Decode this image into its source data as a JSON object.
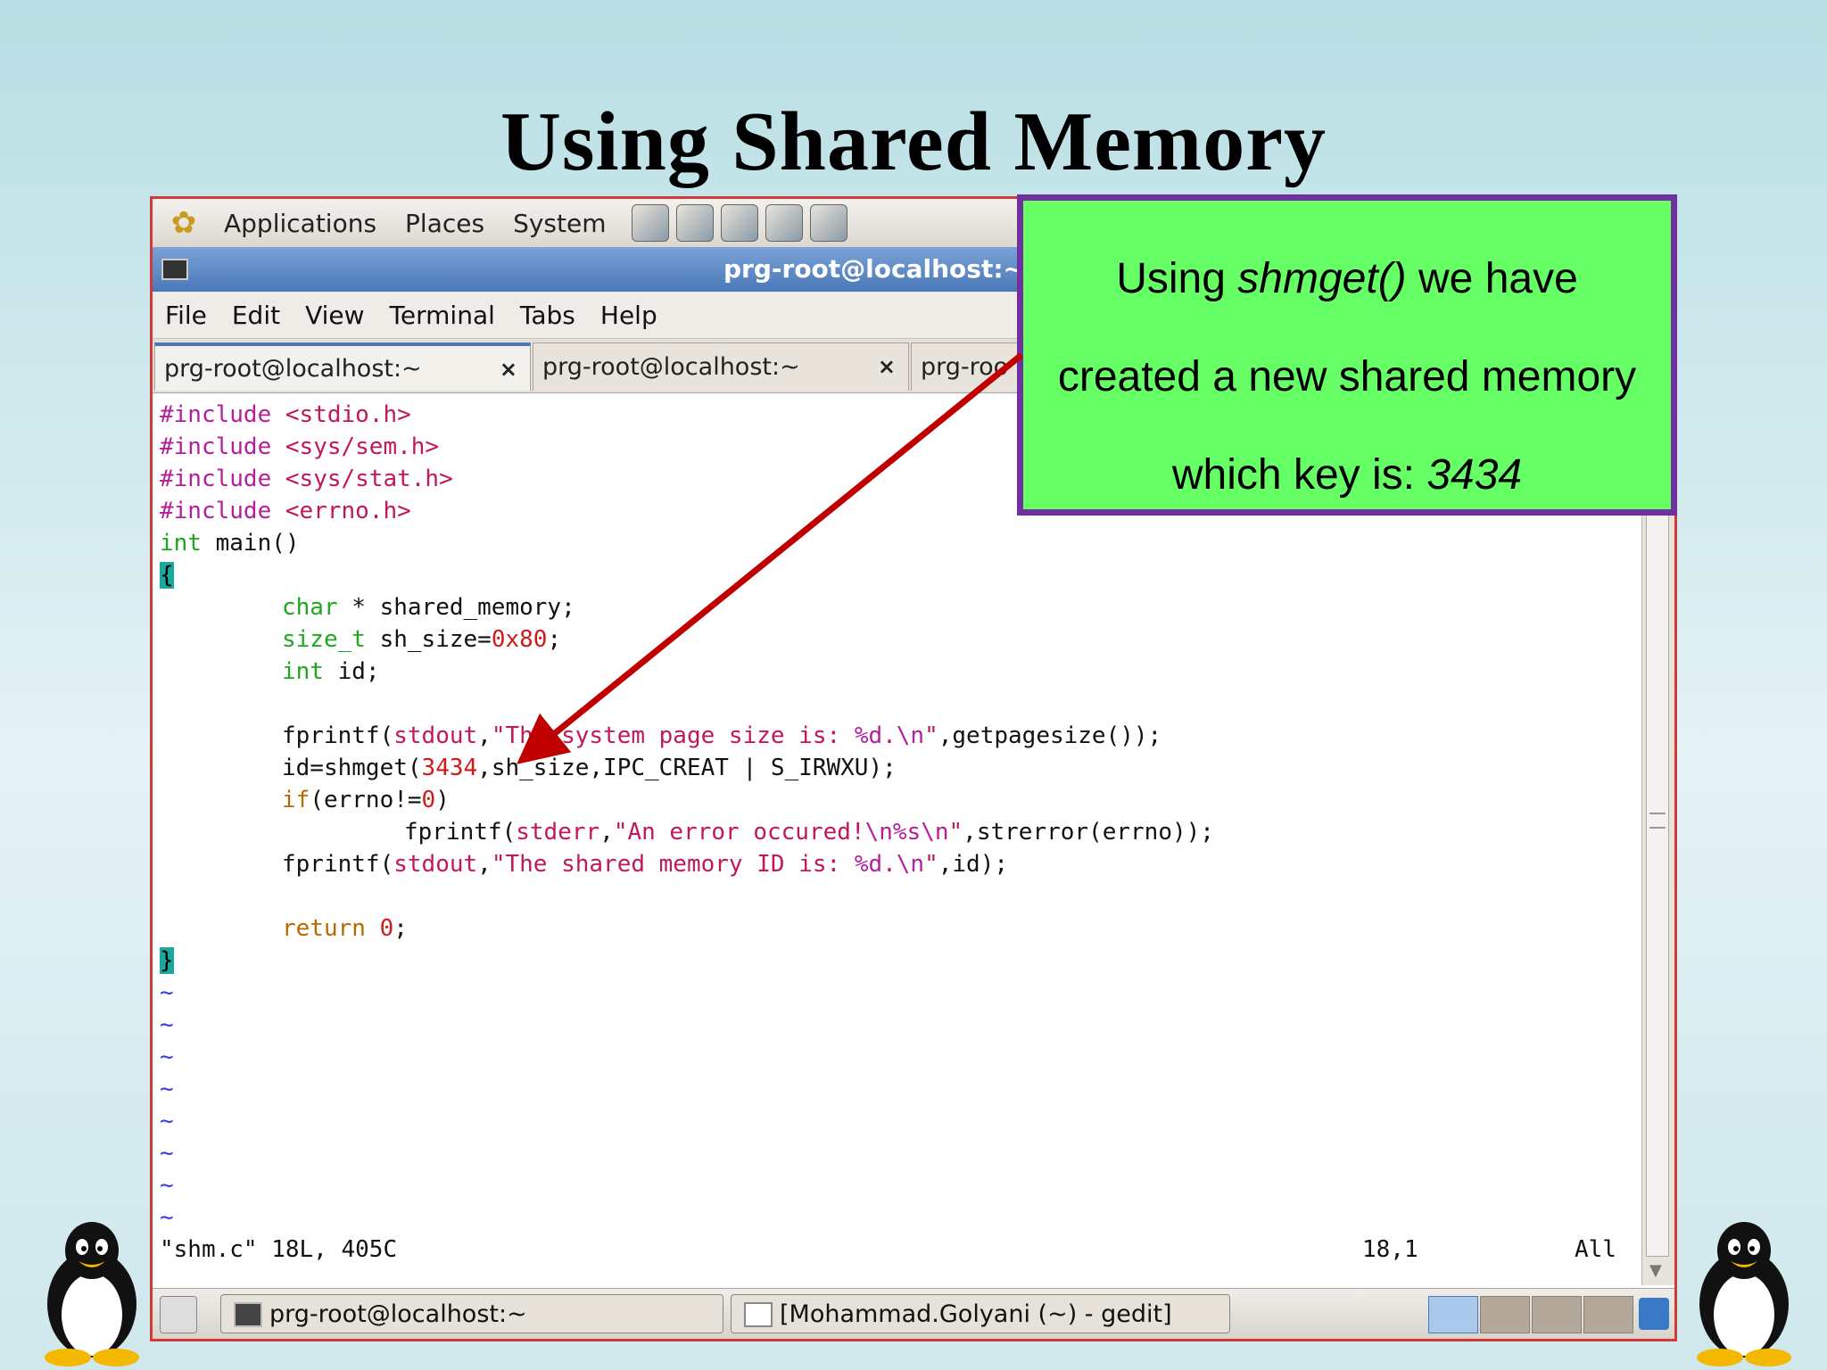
{
  "slide": {
    "title": "Using Shared Memory"
  },
  "panel": {
    "menus": [
      "Applications",
      "Places",
      "System"
    ]
  },
  "window": {
    "title": "prg-root@localhost:~"
  },
  "menubar": [
    "File",
    "Edit",
    "View",
    "Terminal",
    "Tabs",
    "Help"
  ],
  "tabs": [
    {
      "label": "prg-root@localhost:~",
      "close": "×"
    },
    {
      "label": "prg-root@localhost:~",
      "close": "×"
    },
    {
      "label": "prg-roo"
    }
  ],
  "code": {
    "l1": "#include",
    "l1b": " <stdio.h>",
    "l2": "#include",
    "l2b": " <sys/sem.h>",
    "l3": "#include",
    "l3b": " <sys/stat.h>",
    "l4": "#include",
    "l4b": " <errno.h>",
    "l5a": "int",
    "l5b": " main()",
    "l6": "{",
    "l7a": "char",
    "l7b": " * shared_memory;",
    "l8a": "size_t",
    "l8b": " sh_size=",
    "l8c": "0x80",
    "l8d": ";",
    "l9a": "int",
    "l9b": " id;",
    "l10a": "fprintf(",
    "l10b": "stdout",
    "l10c": ",",
    "l10d": "\"The system page size is: ",
    "l10e": "%d",
    "l10f": ".",
    "l10g": "\\n",
    "l10h": "\"",
    "l10i": ",getpagesize());",
    "l11a": "id=shmget(",
    "l11b": "3434",
    "l11c": ",sh_size,IPC_CREAT | S_IRWXU);",
    "l12a": "if",
    "l12b": "(errno!=",
    "l12c": "0",
    "l12d": ")",
    "l13a": "fprintf(",
    "l13b": "stderr",
    "l13c": ",",
    "l13d": "\"An error occured!",
    "l13e": "\\n",
    "l13f": "%s",
    "l13g": "\\n",
    "l13h": "\"",
    "l13i": ",strerror(errno));",
    "l14a": "fprintf(",
    "l14b": "stdout",
    "l14c": ",",
    "l14d": "\"The shared memory ID is: ",
    "l14e": "%d",
    "l14f": ".",
    "l14g": "\\n",
    "l14h": "\"",
    "l14i": ",id);",
    "l15a": "return",
    "l15b": " 0",
    "l15c": ";",
    "l16": "}",
    "tilde": "~"
  },
  "status": {
    "left": "\"shm.c\" 18L, 405C",
    "pos": "18,1",
    "scroll": "All"
  },
  "taskbar": [
    {
      "label": "prg-root@localhost:~"
    },
    {
      "label": "[Mohammad.Golyani (~) - gedit]"
    }
  ],
  "callout": {
    "line1_pre": "Using ",
    "line1_em": "shmget()",
    "line1_post": "  we have",
    "line2": "created a new shared memory",
    "line3_pre": "which key is: ",
    "line3_em": "3434"
  },
  "colors": {
    "callout_bg": "#66ff66",
    "callout_border": "#7030a0",
    "arrow": "#c00000"
  }
}
